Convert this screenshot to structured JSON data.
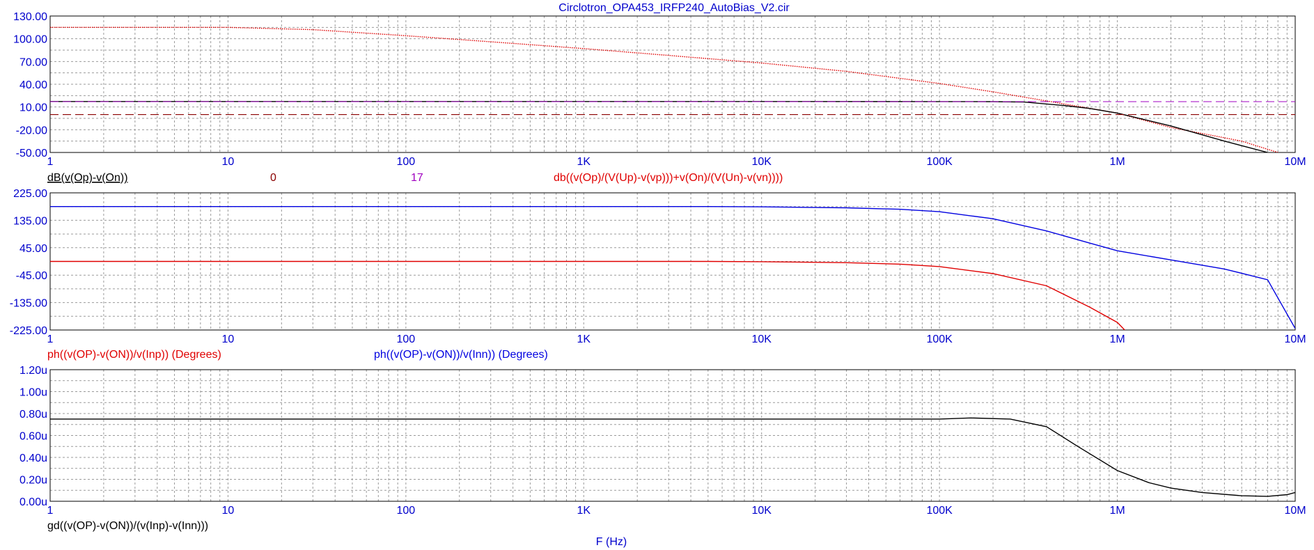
{
  "title": "Circlotron_OPA453_IRFP240_AutoBias_V2.cir",
  "xlabel": "F (Hz)",
  "colors": {
    "axis_text": "#0000cc",
    "grid": "#9a9a9a",
    "red": "#e00000",
    "blue": "#0000e0",
    "black": "#000000",
    "dark_red": "#8b0000",
    "purple": "#a000c0"
  },
  "x_ticks": [
    "1",
    "10",
    "100",
    "1K",
    "10K",
    "100K",
    "1M",
    "10M"
  ],
  "panels": [
    {
      "y_ticks": [
        "130.00",
        "100.00",
        "70.00",
        "40.00",
        "10.00",
        "-20.00",
        "-50.00"
      ],
      "legend": [
        {
          "text": "dB(v(Op)-v(On))",
          "color": "#000000",
          "underline": true
        },
        {
          "text": "0",
          "color": "#8b0000"
        },
        {
          "text": "17",
          "color": "#a000c0"
        },
        {
          "text": "db((v(Op)/(V(Up)-v(vp)))+v(On)/(V(Un)-v(vn))))",
          "color": "#e00000"
        }
      ]
    },
    {
      "y_ticks": [
        "225.00",
        "135.00",
        "45.00",
        "-45.00",
        "-135.00",
        "-225.00"
      ],
      "legend": [
        {
          "text": "ph((v(OP)-v(ON))/v(Inp)) (Degrees)",
          "color": "#e00000"
        },
        {
          "text": "ph((v(OP)-v(ON))/v(Inn)) (Degrees)",
          "color": "#0000e0"
        }
      ]
    },
    {
      "y_ticks": [
        "1.20u",
        "1.00u",
        "0.80u",
        "0.60u",
        "0.40u",
        "0.20u",
        "0.00u"
      ],
      "legend": [
        {
          "text": "gd((v(OP)-v(ON))/(v(Inp)-v(Inn)))",
          "color": "#000000"
        }
      ]
    }
  ],
  "chart_data": [
    {
      "type": "line",
      "x_scale": "log",
      "xlim": [
        1,
        10000000
      ],
      "ylim": [
        -50,
        130
      ],
      "series": [
        {
          "name": "db((v(Op)/(V(Up)-v(vp)))+v(On)/(V(Un)-v(vn))))",
          "color": "#e00000",
          "style": "dotted",
          "x": [
            1,
            10,
            30,
            100,
            300,
            1000,
            3000,
            10000,
            30000,
            100000,
            200000,
            400000,
            1000000,
            2000000,
            5000000,
            8000000
          ],
          "y": [
            115,
            115,
            112,
            104,
            96,
            87,
            78,
            68,
            57,
            41,
            30,
            18,
            2,
            -17,
            -35,
            -50
          ]
        },
        {
          "name": "dB(v(Op)-v(On))",
          "color": "#000000",
          "style": "solid",
          "x": [
            1,
            10,
            100,
            1000,
            10000,
            100000,
            200000,
            300000,
            500000,
            700000,
            1000000,
            2000000,
            4000000,
            7000000
          ],
          "y": [
            17.2,
            17.2,
            17.2,
            17.2,
            17.2,
            17.1,
            17.0,
            16.5,
            12.0,
            8.0,
            2.0,
            -15.0,
            -35.0,
            -50.0
          ]
        },
        {
          "name": "0",
          "color": "#8b0000",
          "style": "dashed",
          "x": [
            1,
            10000000
          ],
          "y": [
            0,
            0
          ]
        },
        {
          "name": "17",
          "color": "#a000c0",
          "style": "dashed",
          "x": [
            1,
            10000000
          ],
          "y": [
            17,
            17
          ]
        }
      ]
    },
    {
      "type": "line",
      "x_scale": "log",
      "xlim": [
        1,
        10000000
      ],
      "ylim": [
        -225,
        225
      ],
      "series": [
        {
          "name": "ph((v(OP)-v(ON))/v(Inn)) (Degrees)",
          "color": "#0000e0",
          "x": [
            1,
            1000,
            5000,
            10000,
            30000,
            60000,
            100000,
            200000,
            400000,
            700000,
            1000000,
            2000000,
            4000000,
            7000000,
            10000000
          ],
          "y": [
            180,
            180,
            180,
            179,
            176,
            171,
            163,
            140,
            100,
            60,
            35,
            5,
            -25,
            -60,
            -220
          ]
        },
        {
          "name": "ph((v(OP)-v(ON))/v(Inp)) (Degrees)",
          "color": "#e00000",
          "x": [
            1,
            1000,
            5000,
            10000,
            30000,
            60000,
            100000,
            200000,
            400000,
            700000,
            1000000,
            1100000
          ],
          "y": [
            0,
            0,
            0,
            -1,
            -4,
            -9,
            -17,
            -40,
            -80,
            -150,
            -200,
            -225
          ]
        }
      ]
    },
    {
      "type": "line",
      "x_scale": "log",
      "xlim": [
        1,
        10000000
      ],
      "ylim": [
        0,
        1.2
      ],
      "series": [
        {
          "name": "gd((v(OP)-v(ON))/(v(Inp)-v(Inn)))",
          "color": "#000000",
          "x": [
            1,
            100000,
            150000,
            250000,
            400000,
            600000,
            1000000,
            1500000,
            2000000,
            3000000,
            5000000,
            7000000,
            9000000,
            10000000
          ],
          "y": [
            0.75,
            0.75,
            0.76,
            0.75,
            0.68,
            0.5,
            0.28,
            0.17,
            0.12,
            0.08,
            0.05,
            0.045,
            0.06,
            0.08
          ]
        }
      ]
    }
  ]
}
